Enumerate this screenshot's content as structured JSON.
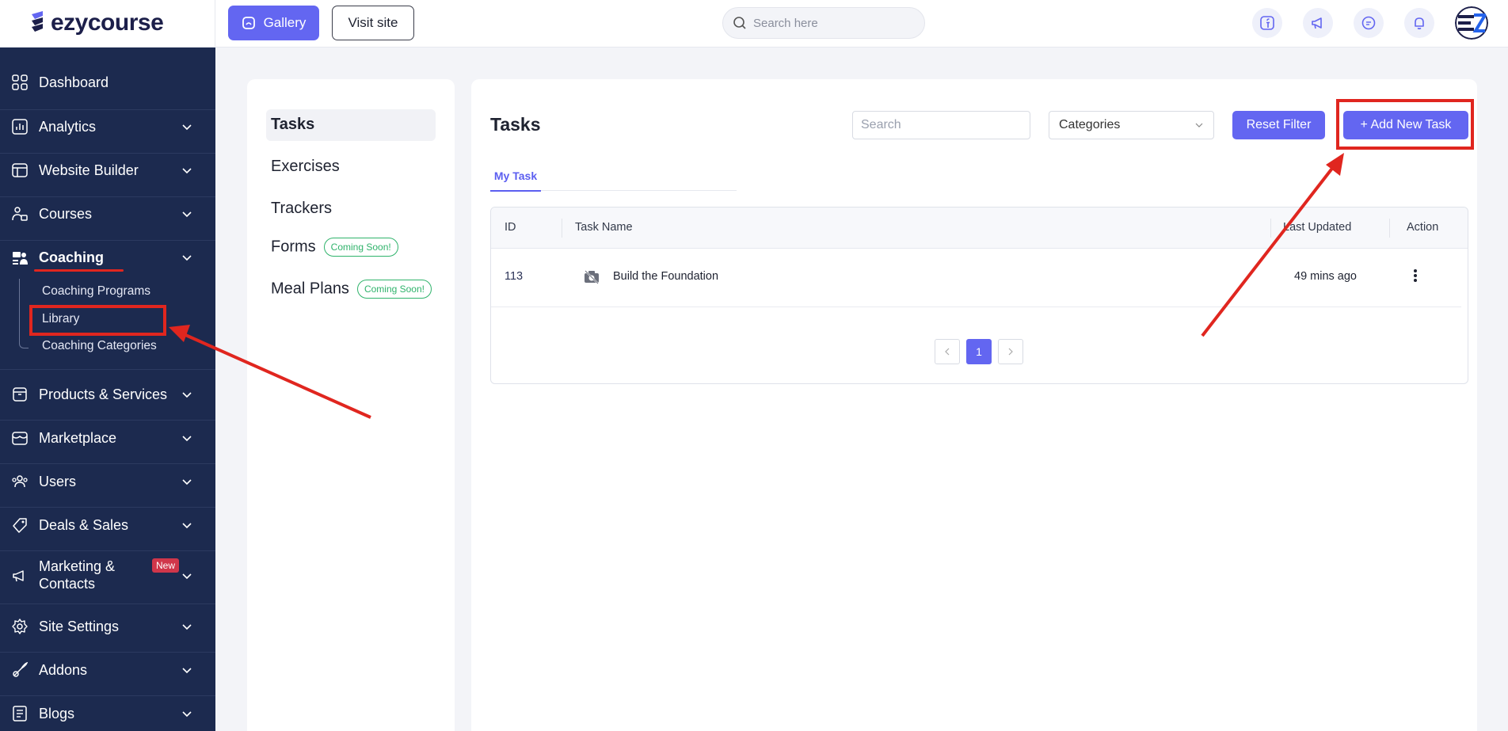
{
  "brand": {
    "name": "ezycourse"
  },
  "topbar": {
    "gallery_label": "Gallery",
    "visit_label": "Visit site",
    "search_placeholder": "Search here"
  },
  "sidebar": {
    "items": [
      {
        "label": "Dashboard",
        "icon": "dashboard-icon"
      },
      {
        "label": "Analytics",
        "icon": "analytics-icon"
      },
      {
        "label": "Website Builder",
        "icon": "website-builder-icon"
      },
      {
        "label": "Courses",
        "icon": "courses-icon"
      },
      {
        "label": "Coaching",
        "icon": "coaching-icon"
      },
      {
        "label": "Products & Services",
        "icon": "products-icon"
      },
      {
        "label": "Marketplace",
        "icon": "marketplace-icon"
      },
      {
        "label": "Users",
        "icon": "users-icon"
      },
      {
        "label": "Deals & Sales",
        "icon": "deals-icon"
      },
      {
        "label": "Marketing & Contacts",
        "icon": "marketing-icon",
        "badge": "New"
      },
      {
        "label": "Site Settings",
        "icon": "settings-icon"
      },
      {
        "label": "Addons",
        "icon": "addons-icon"
      },
      {
        "label": "Blogs",
        "icon": "blogs-icon"
      }
    ],
    "coaching_sub": [
      "Coaching Programs",
      "Library",
      "Coaching Categories"
    ]
  },
  "library": {
    "items": [
      "Tasks",
      "Exercises",
      "Trackers",
      "Forms",
      "Meal Plans"
    ],
    "coming_soon": "Coming Soon!"
  },
  "main": {
    "title": "Tasks",
    "search_placeholder": "Search",
    "categories_label": "Categories",
    "reset_label": "Reset Filter",
    "add_label": "+ Add New Task",
    "tab_label": "My Task",
    "columns": [
      "ID",
      "Task Name",
      "Last Updated",
      "Action"
    ],
    "rows": [
      {
        "id": "113",
        "name": "Build the Foundation",
        "updated": "49 mins ago"
      }
    ],
    "pagination": {
      "current": "1"
    }
  },
  "colors": {
    "accent": "#6366f1",
    "sidebar": "#1c2a4f",
    "annotation": "#e0261f"
  }
}
